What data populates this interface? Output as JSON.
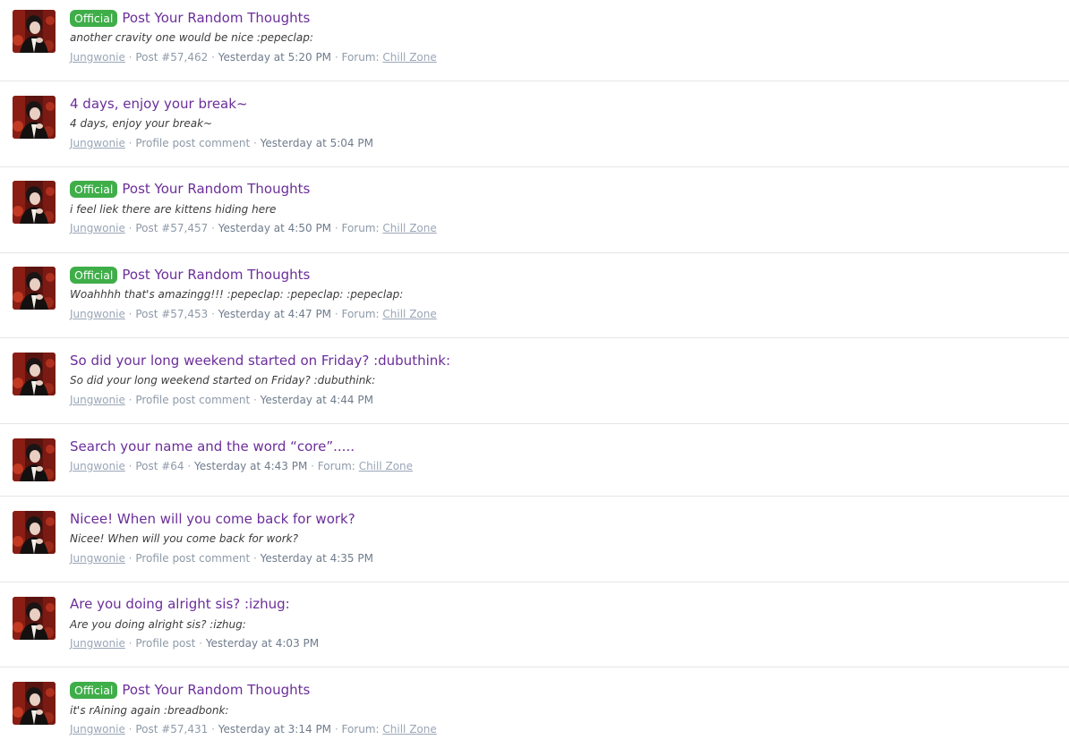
{
  "colors": {
    "badge": "#3fae49",
    "title": "#6b2e9a",
    "meta": "#8e9aa8",
    "divider": "#e3e5e8"
  },
  "items": [
    {
      "badge": "Official",
      "title": "Post Your Random Thoughts",
      "snippet": "another cravity one would be nice :pepeclap:",
      "user": "Jungwonie",
      "type": "Post #57,462",
      "time": "Yesterday at 5:20 PM",
      "forum_label": "Forum:",
      "forum": "Chill Zone"
    },
    {
      "badge": "",
      "title": "4 days, enjoy your break~",
      "snippet": "4 days, enjoy your break~",
      "user": "Jungwonie",
      "type": "Profile post comment",
      "time": "Yesterday at 5:04 PM",
      "forum_label": "",
      "forum": ""
    },
    {
      "badge": "Official",
      "title": "Post Your Random Thoughts",
      "snippet": "i feel liek there are kittens hiding here",
      "user": "Jungwonie",
      "type": "Post #57,457",
      "time": "Yesterday at 4:50 PM",
      "forum_label": "Forum:",
      "forum": "Chill Zone"
    },
    {
      "badge": "Official",
      "title": "Post Your Random Thoughts",
      "snippet": "Woahhhh that's amazingg!!! :pepeclap: :pepeclap: :pepeclap:",
      "user": "Jungwonie",
      "type": "Post #57,453",
      "time": "Yesterday at 4:47 PM",
      "forum_label": "Forum:",
      "forum": "Chill Zone"
    },
    {
      "badge": "",
      "title": "So did your long weekend started on Friday? :dubuthink:",
      "snippet": "So did your long weekend started on Friday? :dubuthink:",
      "user": "Jungwonie",
      "type": "Profile post comment",
      "time": "Yesterday at 4:44 PM",
      "forum_label": "",
      "forum": ""
    },
    {
      "badge": "",
      "title": "Search your name and the word “core”.....",
      "snippet": "",
      "user": "Jungwonie",
      "type": "Post #64",
      "time": "Yesterday at 4:43 PM",
      "forum_label": "Forum:",
      "forum": "Chill Zone"
    },
    {
      "badge": "",
      "title": "Nicee! When will you come back for work?",
      "snippet": "Nicee! When will you come back for work?",
      "user": "Jungwonie",
      "type": "Profile post comment",
      "time": "Yesterday at 4:35 PM",
      "forum_label": "",
      "forum": ""
    },
    {
      "badge": "",
      "title": "Are you doing alright sis? :izhug:",
      "snippet": "Are you doing alright sis? :izhug:",
      "user": "Jungwonie",
      "type": "Profile post",
      "time": "Yesterday at 4:03 PM",
      "forum_label": "",
      "forum": ""
    },
    {
      "badge": "Official",
      "title": "Post Your Random Thoughts",
      "snippet": "it's rAining again :breadbonk:",
      "user": "Jungwonie",
      "type": "Post #57,431",
      "time": "Yesterday at 3:14 PM",
      "forum_label": "Forum:",
      "forum": "Chill Zone"
    }
  ]
}
